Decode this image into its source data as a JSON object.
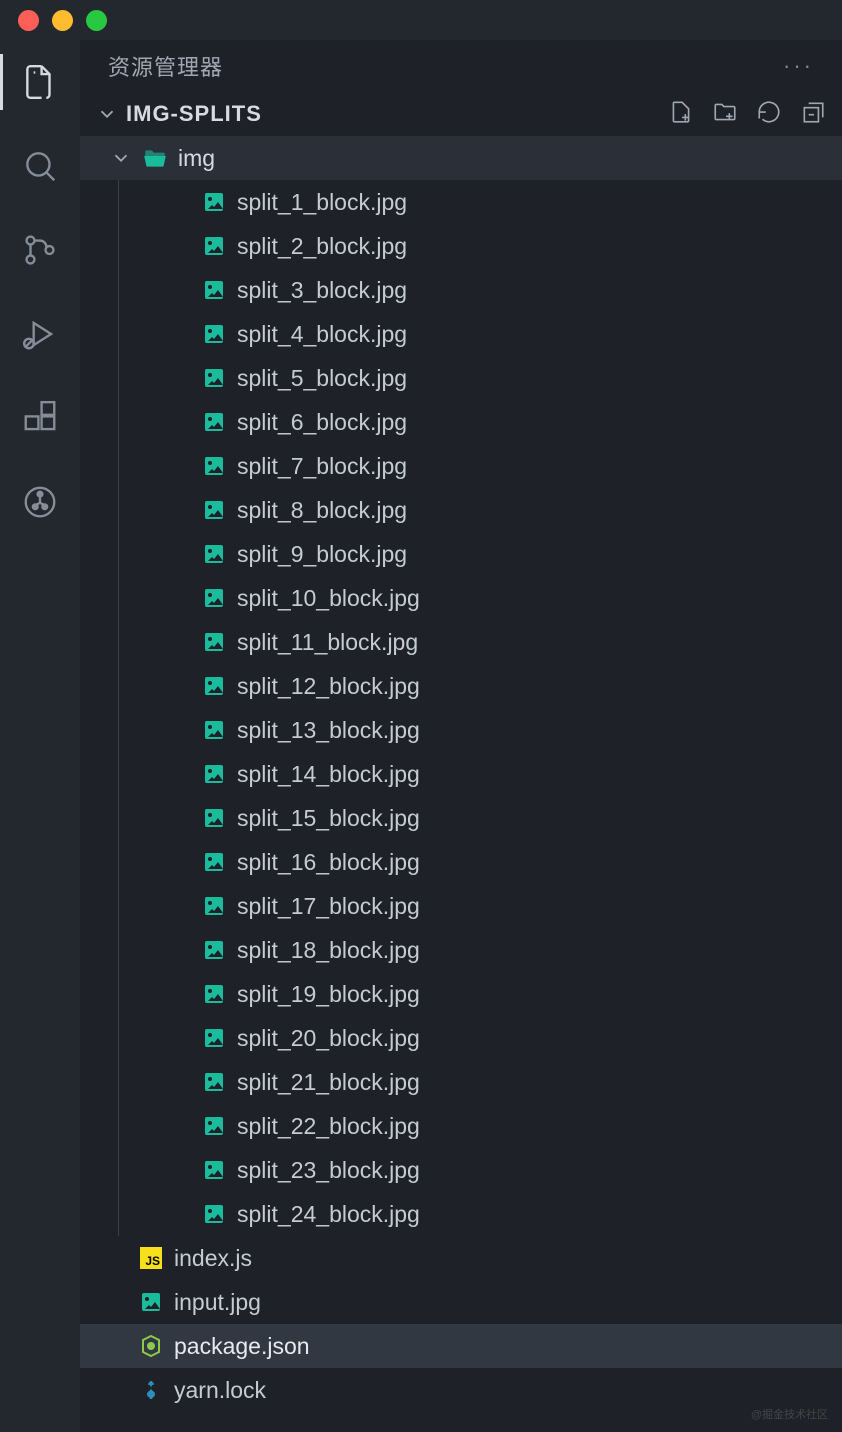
{
  "sidebar": {
    "title": "资源管理器",
    "project": "IMG-SPLITS",
    "tree": {
      "folder": "img",
      "files": [
        "split_1_block.jpg",
        "split_2_block.jpg",
        "split_3_block.jpg",
        "split_4_block.jpg",
        "split_5_block.jpg",
        "split_6_block.jpg",
        "split_7_block.jpg",
        "split_8_block.jpg",
        "split_9_block.jpg",
        "split_10_block.jpg",
        "split_11_block.jpg",
        "split_12_block.jpg",
        "split_13_block.jpg",
        "split_14_block.jpg",
        "split_15_block.jpg",
        "split_16_block.jpg",
        "split_17_block.jpg",
        "split_18_block.jpg",
        "split_19_block.jpg",
        "split_20_block.jpg",
        "split_21_block.jpg",
        "split_22_block.jpg",
        "split_23_block.jpg",
        "split_24_block.jpg"
      ],
      "rootfiles": [
        {
          "name": "index.js",
          "type": "js"
        },
        {
          "name": "input.jpg",
          "type": "image"
        },
        {
          "name": "package.json",
          "type": "json",
          "selected": true
        },
        {
          "name": "yarn.lock",
          "type": "yarn"
        }
      ]
    }
  },
  "watermark": "@掘金技术社区"
}
